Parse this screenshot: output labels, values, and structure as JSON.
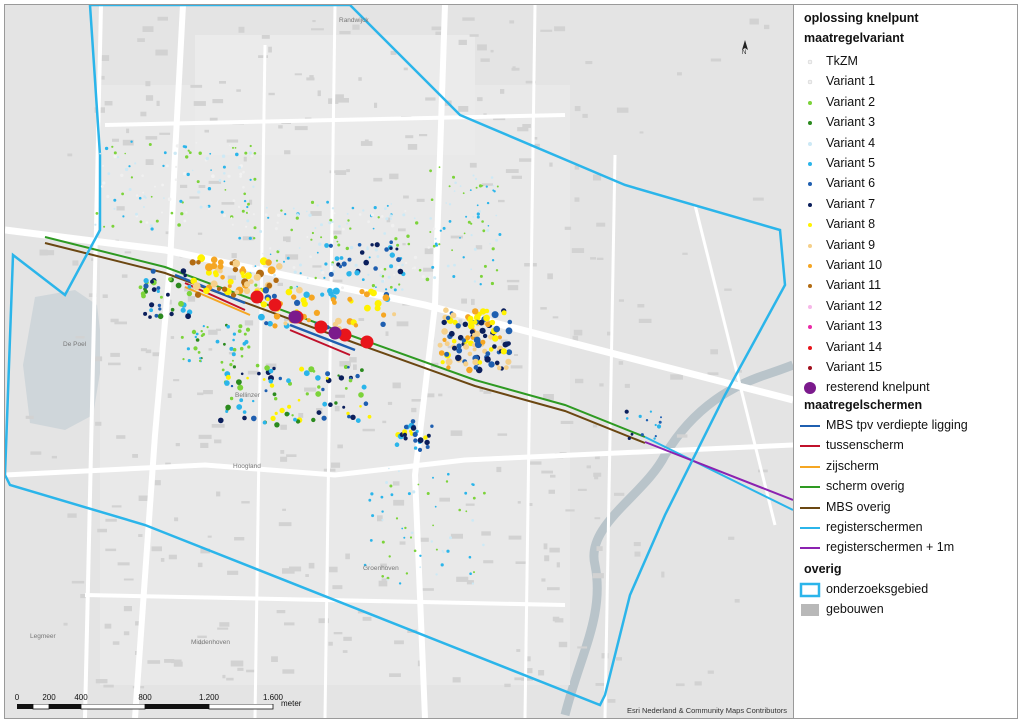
{
  "legend": {
    "title": "oplossing knelpunt",
    "section_variant": "maatregelvariant",
    "variants": [
      {
        "label": "TkZM",
        "color": "#f2f2f2",
        "shape": "dot"
      },
      {
        "label": "Variant 1",
        "color": "#f0f0f0",
        "shape": "dot"
      },
      {
        "label": "Variant 2",
        "color": "#7cd33a",
        "shape": "dot"
      },
      {
        "label": "Variant 3",
        "color": "#2b8a1e",
        "shape": "dot"
      },
      {
        "label": "Variant 4",
        "color": "#cde9f5",
        "shape": "dot"
      },
      {
        "label": "Variant 5",
        "color": "#2bb5ea",
        "shape": "dot"
      },
      {
        "label": "Variant 6",
        "color": "#1f5fb0",
        "shape": "dot"
      },
      {
        "label": "Variant 7",
        "color": "#0b1f5c",
        "shape": "dot"
      },
      {
        "label": "Variant 8",
        "color": "#fff200",
        "shape": "dot"
      },
      {
        "label": "Variant 9",
        "color": "#f5d08a",
        "shape": "dot"
      },
      {
        "label": "Variant 10",
        "color": "#f5a623",
        "shape": "dot"
      },
      {
        "label": "Variant 11",
        "color": "#b26b12",
        "shape": "dot"
      },
      {
        "label": "Variant 12",
        "color": "#f7b8e8",
        "shape": "dot"
      },
      {
        "label": "Variant 13",
        "color": "#ea2aa8",
        "shape": "dot"
      },
      {
        "label": "Variant 14",
        "color": "#e8151b",
        "shape": "dot"
      },
      {
        "label": "Variant 15",
        "color": "#a0101e",
        "shape": "dot"
      },
      {
        "label": "resterend knelpunt",
        "color": "#7b1a8c",
        "shape": "bigdot"
      }
    ],
    "section_screens": "maatregelschermen",
    "screens": [
      {
        "label": "MBS tpv verdiepte ligging",
        "color": "#1f5fb0"
      },
      {
        "label": "tussenscherm",
        "color": "#c0112b"
      },
      {
        "label": "zijscherm",
        "color": "#f5a623"
      },
      {
        "label": "scherm overig",
        "color": "#2e9a22"
      },
      {
        "label": "MBS overig",
        "color": "#6b4712"
      },
      {
        "label": "registerschermen",
        "color": "#2bb5ea"
      },
      {
        "label": "registerschermen + 1m",
        "color": "#8b22b0"
      }
    ],
    "section_other": "overig",
    "other": [
      {
        "label": "onderzoeksgebied",
        "color": "#2bb5ea",
        "shape": "outline"
      },
      {
        "label": "gebouwen",
        "color": "#b8b8b8",
        "shape": "fill"
      }
    ]
  },
  "map": {
    "place_labels": [
      "Randwijck",
      "De Poel",
      "Bellinzer",
      "Hoogland",
      "Groenhoven",
      "Middenhoven",
      "Legmeer"
    ],
    "north_label": "N",
    "credits": "Esri Nederland & Community Maps Contributors",
    "scale": {
      "ticks": [
        "0",
        "200",
        "400",
        "800",
        "1.200",
        "1.600"
      ],
      "unit": "meter"
    }
  }
}
